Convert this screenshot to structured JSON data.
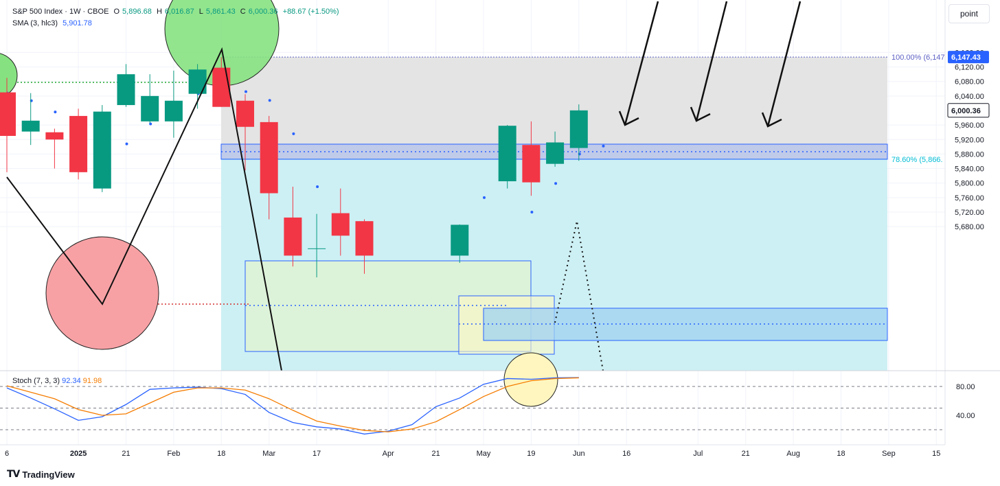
{
  "header": {
    "symbol": "S&P 500 Index · 1W · CBOE",
    "o_label": "O",
    "o_value": "5,896.68",
    "h_label": "H",
    "h_value": "6,016.87",
    "l_label": "L",
    "l_value": "5,861.43",
    "c_label": "C",
    "c_value": "6,000.36",
    "change": "+88.67 (+1.50%)",
    "sma_label": "SMA (3, hlc3)",
    "sma_value": "5,901.78",
    "stoch_label": "Stoch (7, 3, 3)",
    "stoch_k": "92.34",
    "stoch_d": "91.98",
    "mode_button": "point",
    "brand": "TradingView"
  },
  "colors": {
    "up": "#089981",
    "down": "#f23645",
    "sma": "#2962ff",
    "stoch_k": "#2962ff",
    "stoch_d": "#f57c00",
    "fib_gray": "#e4e4e4",
    "fib_cyan": "#cdf0f4",
    "fib_cyan_line": "#00bcd4"
  },
  "chart_data": [
    {
      "type": "candlestick",
      "y_ticks": [
        "6,160.00",
        "6,120.00",
        "6,080.00",
        "6,040.00",
        "5,960.00",
        "5,920.00",
        "5,880.00",
        "5,840.00",
        "5,800.00",
        "5,760.00",
        "5,720.00",
        "5,680.00"
      ],
      "ylim": [
        5672,
        6176
      ],
      "x_ticks": [
        {
          "label": "6",
          "slot": 0
        },
        {
          "label": "2025",
          "slot": 3,
          "bold": true
        },
        {
          "label": "21",
          "slot": 5
        },
        {
          "label": "Feb",
          "slot": 7
        },
        {
          "label": "18",
          "slot": 9
        },
        {
          "label": "Mar",
          "slot": 11
        },
        {
          "label": "17",
          "slot": 13
        },
        {
          "label": "Apr",
          "slot": 16
        },
        {
          "label": "21",
          "slot": 18
        },
        {
          "label": "May",
          "slot": 20
        },
        {
          "label": "19",
          "slot": 22
        },
        {
          "label": "Jun",
          "slot": 24
        },
        {
          "label": "16",
          "slot": 26
        },
        {
          "label": "Jul",
          "slot": 29
        },
        {
          "label": "21",
          "slot": 31
        },
        {
          "label": "Aug",
          "slot": 33
        },
        {
          "label": "18",
          "slot": 35
        },
        {
          "label": "Sep",
          "slot": 37
        },
        {
          "label": "15",
          "slot": 39
        }
      ],
      "candles": [
        {
          "slot": 0,
          "o": 6050,
          "h": 6090,
          "l": 5830,
          "c": 5930
        },
        {
          "slot": 1,
          "o": 5942,
          "h": 6048,
          "l": 5905,
          "c": 5972
        },
        {
          "slot": 2,
          "o": 5940,
          "h": 5950,
          "l": 5840,
          "c": 5920
        },
        {
          "slot": 3,
          "o": 5985,
          "h": 6005,
          "l": 5810,
          "c": 5830
        },
        {
          "slot": 4,
          "o": 5785,
          "h": 6015,
          "l": 5775,
          "c": 5997
        },
        {
          "slot": 5,
          "o": 6015,
          "h": 6128,
          "l": 6010,
          "c": 6100
        },
        {
          "slot": 6,
          "o": 5970,
          "h": 6100,
          "l": 5965,
          "c": 6040
        },
        {
          "slot": 7,
          "o": 5970,
          "h": 6110,
          "l": 5925,
          "c": 6027
        },
        {
          "slot": 8,
          "o": 6046,
          "h": 6128,
          "l": 6005,
          "c": 6113
        },
        {
          "slot": 9,
          "o": 6118,
          "h": 6147,
          "l": 6010,
          "c": 6010
        },
        {
          "slot": 10,
          "o": 6027,
          "h": 6045,
          "l": 5835,
          "c": 5955
        },
        {
          "slot": 11,
          "o": 5968,
          "h": 5985,
          "l": 5700,
          "c": 5772
        },
        {
          "slot": 12,
          "o": 5705,
          "h": 5790,
          "l": 5570,
          "c": 5600
        },
        {
          "slot": 13,
          "o": 5620,
          "h": 5715,
          "l": 5540,
          "c": 5620
        },
        {
          "slot": 14,
          "o": 5717,
          "h": 5785,
          "l": 5600,
          "c": 5655
        },
        {
          "slot": 15,
          "o": 5695,
          "h": 5700,
          "l": 5550,
          "c": 5600
        },
        {
          "slot": 19,
          "o": 5600,
          "h": 5686,
          "l": 5580,
          "c": 5685
        },
        {
          "slot": 21,
          "o": 5805,
          "h": 5960,
          "l": 5785,
          "c": 5958
        },
        {
          "slot": 22,
          "o": 5905,
          "h": 5970,
          "l": 5765,
          "c": 5802
        },
        {
          "slot": 23,
          "o": 5853,
          "h": 5942,
          "l": 5845,
          "c": 5912
        },
        {
          "slot": 24,
          "o": 5896.68,
          "h": 6016.87,
          "l": 5861.43,
          "c": 6000.36
        }
      ],
      "sma": [
        {
          "slot": 0,
          "v": 6048
        },
        {
          "slot": 1,
          "v": 6027
        },
        {
          "slot": 2,
          "v": 5996
        },
        {
          "slot": 3,
          "v": 5945
        },
        {
          "slot": 4,
          "v": 5922
        },
        {
          "slot": 5,
          "v": 5908
        },
        {
          "slot": 6,
          "v": 5963
        },
        {
          "slot": 7,
          "v": 6020
        },
        {
          "slot": 8,
          "v": 6046
        },
        {
          "slot": 9,
          "v": 6048
        },
        {
          "slot": 10,
          "v": 6052
        },
        {
          "slot": 11,
          "v": 6028
        },
        {
          "slot": 12,
          "v": 5936
        },
        {
          "slot": 13,
          "v": 5790
        },
        {
          "slot": 14,
          "v": 5692
        },
        {
          "slot": 20,
          "v": 5760
        },
        {
          "slot": 22,
          "v": 5720
        },
        {
          "slot": 23,
          "v": 5799
        },
        {
          "slot": 24,
          "v": 5880
        },
        {
          "slot": 25,
          "v": 5902
        }
      ],
      "fib_levels": [
        {
          "label": "100.00% (6,147",
          "price": 6147.43
        },
        {
          "label": "78.60% (5,866.",
          "price": 5866
        }
      ],
      "price_tags": [
        {
          "label": "6,147.43",
          "price": 6147.43,
          "style": "blue"
        },
        {
          "label": "6,000.36",
          "price": 6000.36,
          "style": "white"
        }
      ]
    },
    {
      "type": "line",
      "name": "Stoch (7, 3, 3)",
      "y_ticks": [
        "80.00",
        "40.00"
      ],
      "ylim": [
        0,
        100
      ],
      "bands": [
        80,
        50,
        20
      ],
      "series": [
        {
          "name": "%K",
          "values": [
            {
              "slot": 0,
              "v": 78
            },
            {
              "slot": 1,
              "v": 64
            },
            {
              "slot": 2,
              "v": 49
            },
            {
              "slot": 3,
              "v": 33
            },
            {
              "slot": 4,
              "v": 38
            },
            {
              "slot": 5,
              "v": 55
            },
            {
              "slot": 6,
              "v": 76
            },
            {
              "slot": 7,
              "v": 78
            },
            {
              "slot": 8,
              "v": 79
            },
            {
              "slot": 9,
              "v": 77
            },
            {
              "slot": 10,
              "v": 69
            },
            {
              "slot": 11,
              "v": 44
            },
            {
              "slot": 12,
              "v": 30
            },
            {
              "slot": 13,
              "v": 24
            },
            {
              "slot": 14,
              "v": 21
            },
            {
              "slot": 15,
              "v": 14
            },
            {
              "slot": 16,
              "v": 18
            },
            {
              "slot": 17,
              "v": 27
            },
            {
              "slot": 18,
              "v": 52
            },
            {
              "slot": 19,
              "v": 64
            },
            {
              "slot": 20,
              "v": 83
            },
            {
              "slot": 21,
              "v": 91
            },
            {
              "slot": 22,
              "v": 90
            },
            {
              "slot": 23,
              "v": 92
            },
            {
              "slot": 24,
              "v": 92.34
            }
          ]
        },
        {
          "name": "%D",
          "values": [
            {
              "slot": 0,
              "v": 81
            },
            {
              "slot": 1,
              "v": 72
            },
            {
              "slot": 2,
              "v": 63
            },
            {
              "slot": 3,
              "v": 48
            },
            {
              "slot": 4,
              "v": 40
            },
            {
              "slot": 5,
              "v": 42
            },
            {
              "slot": 6,
              "v": 57
            },
            {
              "slot": 7,
              "v": 72
            },
            {
              "slot": 8,
              "v": 78
            },
            {
              "slot": 9,
              "v": 78
            },
            {
              "slot": 10,
              "v": 75
            },
            {
              "slot": 11,
              "v": 63
            },
            {
              "slot": 12,
              "v": 47
            },
            {
              "slot": 13,
              "v": 32
            },
            {
              "slot": 14,
              "v": 25
            },
            {
              "slot": 15,
              "v": 19
            },
            {
              "slot": 16,
              "v": 17
            },
            {
              "slot": 17,
              "v": 21
            },
            {
              "slot": 18,
              "v": 31
            },
            {
              "slot": 19,
              "v": 48
            },
            {
              "slot": 20,
              "v": 66
            },
            {
              "slot": 21,
              "v": 80
            },
            {
              "slot": 22,
              "v": 88
            },
            {
              "slot": 23,
              "v": 91
            },
            {
              "slot": 24,
              "v": 91.98
            }
          ]
        }
      ]
    }
  ]
}
